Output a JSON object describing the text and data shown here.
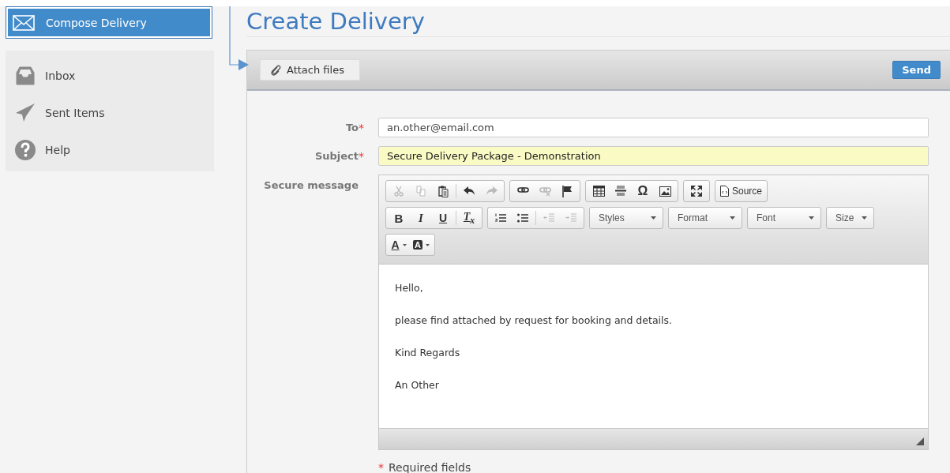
{
  "sidebar": {
    "compose": {
      "label": "Compose Delivery",
      "selected": true
    },
    "items": [
      {
        "kind": "inbox",
        "label": "Inbox",
        "selected": false
      },
      {
        "kind": "sent",
        "label": "Sent Items",
        "selected": false
      },
      {
        "kind": "help",
        "label": "Help",
        "selected": false
      }
    ]
  },
  "page": {
    "title": "Create Delivery"
  },
  "toolbar": {
    "attach_label": "Attach files",
    "send_label": "Send"
  },
  "form": {
    "fields": [
      {
        "label": "To",
        "required_mark": "*",
        "value": "an.other@email.com",
        "highlighted": false
      },
      {
        "label": "Subject",
        "required_mark": "*",
        "value": "Secure Delivery Package - Demonstration",
        "highlighted": true
      }
    ],
    "message_label": "Secure message",
    "editor": {
      "rows": [
        [
          {
            "kind": "buttons",
            "items": [
              {
                "kind": "cut",
                "disabled": true
              },
              {
                "kind": "copy",
                "disabled": true
              },
              {
                "kind": "paste",
                "disabled": false
              },
              {
                "kind": "separator"
              },
              {
                "kind": "undo",
                "disabled": false
              },
              {
                "kind": "redo",
                "disabled": true
              }
            ]
          },
          {
            "kind": "buttons",
            "items": [
              {
                "kind": "link",
                "disabled": false
              },
              {
                "kind": "unlink",
                "disabled": true
              },
              {
                "kind": "anchor",
                "disabled": false
              }
            ]
          },
          {
            "kind": "buttons",
            "items": [
              {
                "kind": "table",
                "disabled": false
              },
              {
                "kind": "hline",
                "disabled": false
              },
              {
                "kind": "char",
                "label": "Ω",
                "disabled": false
              },
              {
                "kind": "image",
                "disabled": false
              }
            ]
          },
          {
            "kind": "buttons",
            "items": [
              {
                "kind": "maximize",
                "disabled": false
              }
            ]
          },
          {
            "kind": "buttons",
            "items": [
              {
                "kind": "source",
                "label": "Source",
                "disabled": false
              }
            ]
          }
        ],
        [
          {
            "kind": "buttons",
            "items": [
              {
                "kind": "bold",
                "label": "B",
                "disabled": false
              },
              {
                "kind": "italic",
                "label": "I",
                "disabled": false
              },
              {
                "kind": "underline",
                "label": "U",
                "disabled": false
              },
              {
                "kind": "separator"
              },
              {
                "kind": "removeformat",
                "label": "T$_{x}$",
                "disabled": false
              }
            ]
          },
          {
            "kind": "buttons",
            "items": [
              {
                "kind": "ol",
                "disabled": false
              },
              {
                "kind": "ul",
                "disabled": false
              },
              {
                "kind": "separator"
              },
              {
                "kind": "outdent",
                "disabled": true
              },
              {
                "kind": "indent",
                "disabled": true
              }
            ]
          },
          {
            "kind": "dropdown",
            "label": "Styles"
          },
          {
            "kind": "dropdown",
            "label": "Format"
          },
          {
            "kind": "dropdown",
            "label": "Font"
          },
          {
            "kind": "dropdown",
            "label": "Size"
          }
        ],
        [
          {
            "kind": "buttons",
            "items": [
              {
                "kind": "textcolor",
                "label": "A",
                "disabled": false
              },
              {
                "kind": "bgcolor",
                "label": "A",
                "disabled": false
              }
            ]
          }
        ]
      ],
      "paragraphs": [
        "Hello,",
        "please find attached by request for booking and details.",
        "Kind Regards",
        "An Other"
      ]
    },
    "required_note": {
      "mark": "*",
      "text": "Required fields"
    }
  }
}
